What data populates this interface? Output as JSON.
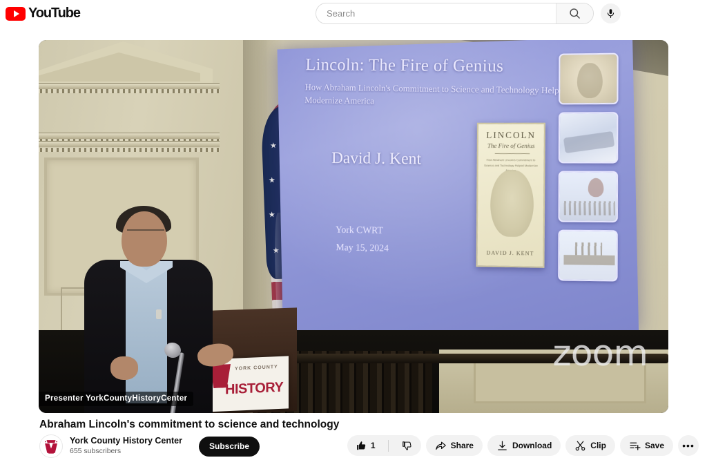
{
  "masthead": {
    "logo_text": "YouTube",
    "logo_icon": "youtube-play-icon",
    "search": {
      "placeholder": "Search",
      "value": "",
      "search_icon": "search-icon",
      "mic_icon": "microphone-icon"
    }
  },
  "player": {
    "presenter_overlay": "Presenter YorkCountyHistoryCenter",
    "watermark": "zoom",
    "slide": {
      "title": "Lincoln: The Fire of Genius",
      "subtitle": "How Abraham Lincoln's Commitment to Science and Technology Helped Modernize America",
      "author": "David J. Kent",
      "organization": "York CWRT",
      "date": "May 15, 2024",
      "book_cover": {
        "title": "LINCOLN",
        "subtitle": "The Fire of Genius",
        "blurb": "How Abraham Lincoln's Commitment to Science and Technology Helped Modernize America",
        "author": "DAVID J. KENT"
      },
      "thumbnails": [
        "lincoln-portrait-thumbnail",
        "steamboat-thumbnail",
        "balloon-thumbnail",
        "bridge-thumbnail"
      ]
    },
    "podium_sign": {
      "top_text": "YORK COUNTY",
      "main_text": "HISTORY"
    }
  },
  "video": {
    "title": "Abraham Lincoln's commitment to science and technology",
    "channel": {
      "name": "York County History Center",
      "subscribers": "655 subscribers",
      "avatar_icon": "york-county-history-center-logo"
    },
    "subscribe_label": "Subscribe",
    "actions": {
      "like_count": "1",
      "like_icon": "thumbs-up-icon",
      "dislike_icon": "thumbs-down-icon",
      "share_label": "Share",
      "share_icon": "share-arrow-icon",
      "download_label": "Download",
      "download_icon": "download-icon",
      "clip_label": "Clip",
      "clip_icon": "scissors-icon",
      "save_label": "Save",
      "save_icon": "save-playlist-icon",
      "more_label": "•••",
      "more_icon": "more-horizontal-icon"
    }
  },
  "colors": {
    "brand_red": "#ff0000",
    "logo_crimson": "#a81f38",
    "text_primary": "#0f0f0f",
    "text_secondary": "#606060",
    "pill_bg": "#f2f2f2",
    "slide_blue": "#8f95d8"
  }
}
